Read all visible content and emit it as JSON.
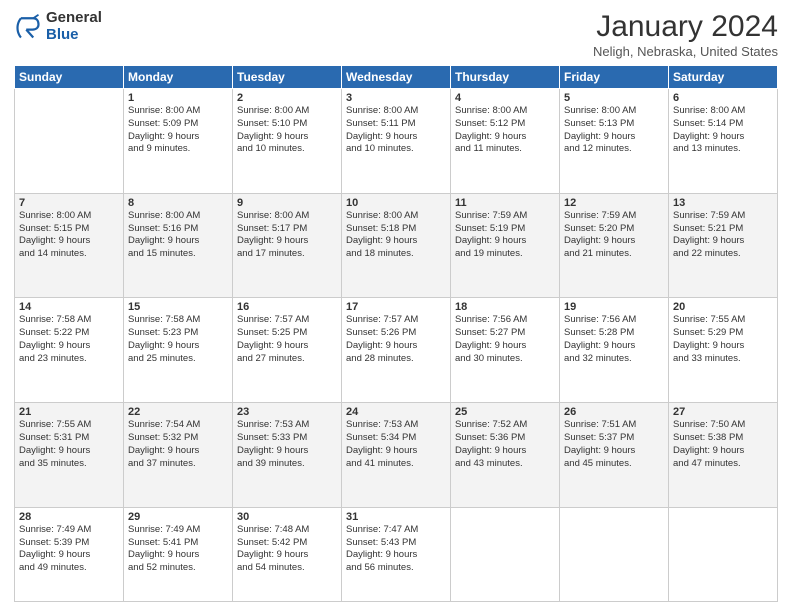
{
  "header": {
    "logo_general": "General",
    "logo_blue": "Blue",
    "title": "January 2024",
    "location": "Neligh, Nebraska, United States"
  },
  "days_of_week": [
    "Sunday",
    "Monday",
    "Tuesday",
    "Wednesday",
    "Thursday",
    "Friday",
    "Saturday"
  ],
  "weeks": [
    [
      {
        "num": "",
        "detail": ""
      },
      {
        "num": "1",
        "detail": "Sunrise: 8:00 AM\nSunset: 5:09 PM\nDaylight: 9 hours\nand 9 minutes."
      },
      {
        "num": "2",
        "detail": "Sunrise: 8:00 AM\nSunset: 5:10 PM\nDaylight: 9 hours\nand 10 minutes."
      },
      {
        "num": "3",
        "detail": "Sunrise: 8:00 AM\nSunset: 5:11 PM\nDaylight: 9 hours\nand 10 minutes."
      },
      {
        "num": "4",
        "detail": "Sunrise: 8:00 AM\nSunset: 5:12 PM\nDaylight: 9 hours\nand 11 minutes."
      },
      {
        "num": "5",
        "detail": "Sunrise: 8:00 AM\nSunset: 5:13 PM\nDaylight: 9 hours\nand 12 minutes."
      },
      {
        "num": "6",
        "detail": "Sunrise: 8:00 AM\nSunset: 5:14 PM\nDaylight: 9 hours\nand 13 minutes."
      }
    ],
    [
      {
        "num": "7",
        "detail": "Sunrise: 8:00 AM\nSunset: 5:15 PM\nDaylight: 9 hours\nand 14 minutes."
      },
      {
        "num": "8",
        "detail": "Sunrise: 8:00 AM\nSunset: 5:16 PM\nDaylight: 9 hours\nand 15 minutes."
      },
      {
        "num": "9",
        "detail": "Sunrise: 8:00 AM\nSunset: 5:17 PM\nDaylight: 9 hours\nand 17 minutes."
      },
      {
        "num": "10",
        "detail": "Sunrise: 8:00 AM\nSunset: 5:18 PM\nDaylight: 9 hours\nand 18 minutes."
      },
      {
        "num": "11",
        "detail": "Sunrise: 7:59 AM\nSunset: 5:19 PM\nDaylight: 9 hours\nand 19 minutes."
      },
      {
        "num": "12",
        "detail": "Sunrise: 7:59 AM\nSunset: 5:20 PM\nDaylight: 9 hours\nand 21 minutes."
      },
      {
        "num": "13",
        "detail": "Sunrise: 7:59 AM\nSunset: 5:21 PM\nDaylight: 9 hours\nand 22 minutes."
      }
    ],
    [
      {
        "num": "14",
        "detail": "Sunrise: 7:58 AM\nSunset: 5:22 PM\nDaylight: 9 hours\nand 23 minutes."
      },
      {
        "num": "15",
        "detail": "Sunrise: 7:58 AM\nSunset: 5:23 PM\nDaylight: 9 hours\nand 25 minutes."
      },
      {
        "num": "16",
        "detail": "Sunrise: 7:57 AM\nSunset: 5:25 PM\nDaylight: 9 hours\nand 27 minutes."
      },
      {
        "num": "17",
        "detail": "Sunrise: 7:57 AM\nSunset: 5:26 PM\nDaylight: 9 hours\nand 28 minutes."
      },
      {
        "num": "18",
        "detail": "Sunrise: 7:56 AM\nSunset: 5:27 PM\nDaylight: 9 hours\nand 30 minutes."
      },
      {
        "num": "19",
        "detail": "Sunrise: 7:56 AM\nSunset: 5:28 PM\nDaylight: 9 hours\nand 32 minutes."
      },
      {
        "num": "20",
        "detail": "Sunrise: 7:55 AM\nSunset: 5:29 PM\nDaylight: 9 hours\nand 33 minutes."
      }
    ],
    [
      {
        "num": "21",
        "detail": "Sunrise: 7:55 AM\nSunset: 5:31 PM\nDaylight: 9 hours\nand 35 minutes."
      },
      {
        "num": "22",
        "detail": "Sunrise: 7:54 AM\nSunset: 5:32 PM\nDaylight: 9 hours\nand 37 minutes."
      },
      {
        "num": "23",
        "detail": "Sunrise: 7:53 AM\nSunset: 5:33 PM\nDaylight: 9 hours\nand 39 minutes."
      },
      {
        "num": "24",
        "detail": "Sunrise: 7:53 AM\nSunset: 5:34 PM\nDaylight: 9 hours\nand 41 minutes."
      },
      {
        "num": "25",
        "detail": "Sunrise: 7:52 AM\nSunset: 5:36 PM\nDaylight: 9 hours\nand 43 minutes."
      },
      {
        "num": "26",
        "detail": "Sunrise: 7:51 AM\nSunset: 5:37 PM\nDaylight: 9 hours\nand 45 minutes."
      },
      {
        "num": "27",
        "detail": "Sunrise: 7:50 AM\nSunset: 5:38 PM\nDaylight: 9 hours\nand 47 minutes."
      }
    ],
    [
      {
        "num": "28",
        "detail": "Sunrise: 7:49 AM\nSunset: 5:39 PM\nDaylight: 9 hours\nand 49 minutes."
      },
      {
        "num": "29",
        "detail": "Sunrise: 7:49 AM\nSunset: 5:41 PM\nDaylight: 9 hours\nand 52 minutes."
      },
      {
        "num": "30",
        "detail": "Sunrise: 7:48 AM\nSunset: 5:42 PM\nDaylight: 9 hours\nand 54 minutes."
      },
      {
        "num": "31",
        "detail": "Sunrise: 7:47 AM\nSunset: 5:43 PM\nDaylight: 9 hours\nand 56 minutes."
      },
      {
        "num": "",
        "detail": ""
      },
      {
        "num": "",
        "detail": ""
      },
      {
        "num": "",
        "detail": ""
      }
    ]
  ]
}
